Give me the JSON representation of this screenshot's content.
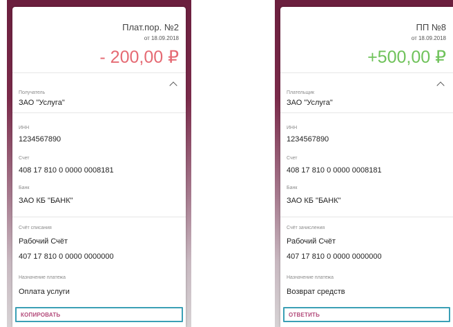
{
  "left": {
    "doc_title": "Плат.пор. №2",
    "doc_date": "от 18.09.2018",
    "amount": "- 200,00 ₽",
    "counterparty_label": "Получатель",
    "counterparty_value": "ЗАО \"Услуга\"",
    "inn_label": "ИНН",
    "inn_value": "1234567890",
    "account_label": "Счет",
    "account_value": "408 17 810 0 0000 0008181",
    "bank_label": "Банк",
    "bank_value": "ЗАО КБ \"БАНК\"",
    "own_account_label": "Счёт списания",
    "own_account_name": "Рабочий Счёт",
    "own_account_number": "407 17 810 0 0000 0000000",
    "purpose_label": "Назначение платежа",
    "purpose_value": "Оплата услуги",
    "action_label": "КОПИРОВАТЬ"
  },
  "right": {
    "doc_title": "ПП №8",
    "doc_date": "от 18.09.2018",
    "amount": "+500,00 ₽",
    "counterparty_label": "Плательщик",
    "counterparty_value": "ЗАО \"Услуга\"",
    "inn_label": "ИНН",
    "inn_value": "1234567890",
    "account_label": "Счет",
    "account_value": "408 17 810 0 0000 0008181",
    "bank_label": "Банк",
    "bank_value": "ЗАО КБ \"БАНК\"",
    "own_account_label": "Счёт зачисления",
    "own_account_name": "Рабочий Счёт",
    "own_account_number": "407 17 810 0 0000 0000000",
    "purpose_label": "Назначение платежа",
    "purpose_value": "Возврат средств",
    "action_label": "ОТВЕТИТЬ"
  },
  "colors": {
    "negative_amount": "#e56a73",
    "positive_amount": "#6fc25a",
    "action_text": "#b34a7a",
    "focus_border": "#3a9fb5",
    "brand_background": "#6b1f3e"
  }
}
